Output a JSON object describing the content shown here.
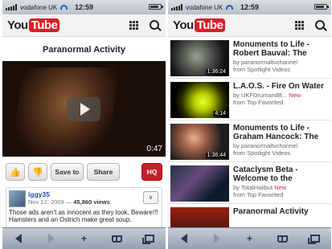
{
  "status": {
    "carrier": "vodafone UK",
    "time": "12:59"
  },
  "header": {
    "logo_you": "You",
    "logo_tube": "Tube"
  },
  "left": {
    "video_title": "Paranormal Activity",
    "duration": "0:47",
    "actions": {
      "like_label": "",
      "dislike_label": "",
      "save_label": "Save to",
      "share_label": "Share",
      "hq_label": "HQ"
    },
    "comment": {
      "user": "iggy35",
      "date": "Nov 12, 2009",
      "sep": " — ",
      "views": "45,860 views",
      "text": "Those ads aren't as innocent as they look, Beware!!! Hamsters and an Ostrich make great soup."
    }
  },
  "right": {
    "videos": [
      {
        "title": "Monuments to Life - Robert Bauval: The",
        "by": "by paranormaltvchannel",
        "from": "from Spotlight Videos",
        "duration": "1:36:24",
        "new": ""
      },
      {
        "title": "L.A.O.S. - Fire On Water",
        "by": "by UKFDrumandB...",
        "from": "from Top Favorited",
        "duration": "4:14",
        "new": "New"
      },
      {
        "title": "Monuments to Life - Graham Hancock: The",
        "by": "by paranormaltvchannel",
        "from": "from Spotlight Videos",
        "duration": "1:36:44",
        "new": ""
      },
      {
        "title": "Cataclysm Beta - Welcome to the",
        "by": "by TotalHalibut",
        "from": "from Top Favorited",
        "duration": "",
        "new": "New"
      },
      {
        "title": "Paranormal Activity",
        "by": "",
        "from": "",
        "duration": "",
        "new": ""
      }
    ]
  },
  "toolbar": {
    "add_glyph": "+"
  },
  "colors": {
    "brand_red": "#d71e25",
    "link_blue": "#1a4fa3",
    "new_red": "#d0262c"
  }
}
